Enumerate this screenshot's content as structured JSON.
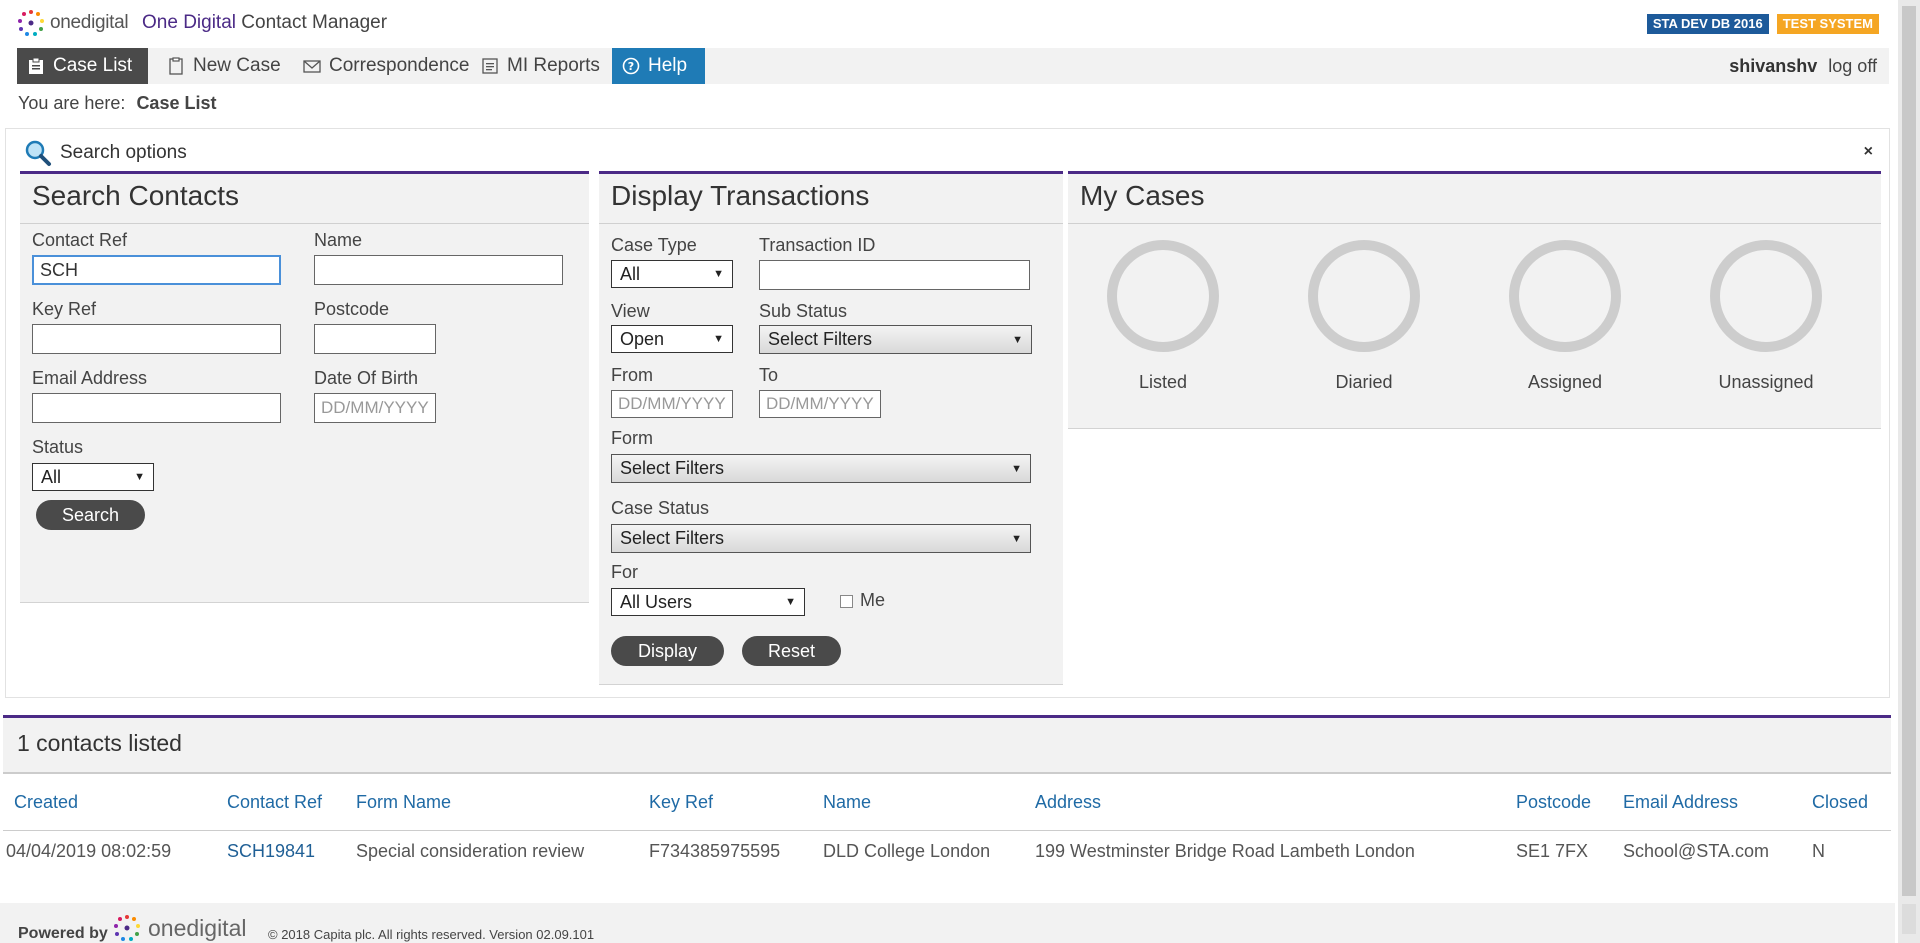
{
  "header": {
    "logo_text": "onedigital",
    "app_title_brand": "One Digital",
    "app_title_rest": "Contact Manager",
    "badges": [
      "STA DEV DB 2016",
      "TEST SYSTEM"
    ]
  },
  "nav": {
    "tabs": [
      {
        "label": "Case List",
        "icon": "clipboard-icon"
      },
      {
        "label": "New Case",
        "icon": "document-icon"
      },
      {
        "label": "Correspondence",
        "icon": "envelope-icon"
      },
      {
        "label": "MI Reports",
        "icon": "reports-icon"
      },
      {
        "label": "Help",
        "icon": "question-icon"
      }
    ],
    "user": "shivanshv",
    "logoff": "log off"
  },
  "breadcrumb": {
    "prefix": "You are here:",
    "current": "Case List"
  },
  "search_options": {
    "title": "Search options",
    "close": "×"
  },
  "search_contacts": {
    "title": "Search Contacts",
    "contact_ref_label": "Contact Ref",
    "contact_ref_value": "SCH",
    "name_label": "Name",
    "key_ref_label": "Key Ref",
    "postcode_label": "Postcode",
    "email_label": "Email Address",
    "dob_label": "Date Of Birth",
    "dob_placeholder": "DD/MM/YYYY",
    "status_label": "Status",
    "status_value": "All",
    "search_button": "Search"
  },
  "display_transactions": {
    "title": "Display Transactions",
    "case_type_label": "Case Type",
    "case_type_value": "All",
    "transaction_id_label": "Transaction ID",
    "view_label": "View",
    "view_value": "Open",
    "sub_status_label": "Sub Status",
    "sub_status_value": "Select Filters",
    "from_label": "From",
    "to_label": "To",
    "date_placeholder": "DD/MM/YYYY",
    "form_label": "Form",
    "form_value": "Select Filters",
    "case_status_label": "Case Status",
    "case_status_value": "Select Filters",
    "for_label": "For",
    "for_value": "All Users",
    "me_label": "Me",
    "display_button": "Display",
    "reset_button": "Reset"
  },
  "my_cases": {
    "title": "My Cases",
    "items": [
      "Listed",
      "Diaried",
      "Assigned",
      "Unassigned"
    ]
  },
  "results": {
    "title": "1 contacts listed",
    "columns": [
      "Created",
      "Contact Ref",
      "Form Name",
      "Key Ref",
      "Name",
      "Address",
      "Postcode",
      "Email Address",
      "Closed"
    ],
    "rows": [
      [
        "04/04/2019 08:02:59",
        "SCH19841",
        "Special consideration review",
        "F734385975595",
        "DLD College London",
        "199 Westminster Bridge Road Lambeth London",
        "SE1 7FX",
        "School@STA.com",
        "N"
      ]
    ]
  },
  "footer": {
    "powered_by": "Powered by",
    "logo_text": "onedigital",
    "copyright": "© 2018 Capita plc. All rights reserved. Version 02.09.101"
  },
  "colors": {
    "brand_purple": "#4b2a86",
    "help_blue": "#1f7bb6",
    "link_blue": "#1f6aa5",
    "badge_db": "#1d5a9a",
    "badge_test": "#f5a623"
  }
}
